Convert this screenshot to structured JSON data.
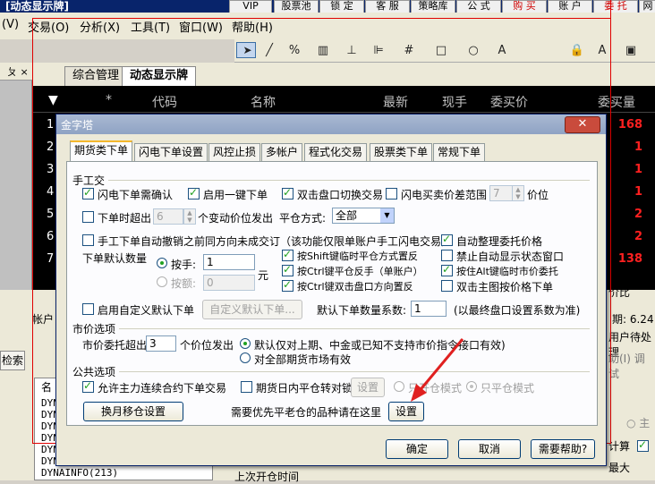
{
  "app": {
    "title": "[动态显示牌]",
    "top_buttons": [
      "VIP",
      "股票池",
      "锁 定",
      "客 服",
      "策略库",
      "公 式",
      "购 买",
      "账 户",
      "委 托",
      "网"
    ],
    "menu": [
      "(V)",
      "交易(O)",
      "分析(X)",
      "工具(T)",
      "窗口(W)",
      "帮助(H)"
    ],
    "toolbar_icons": [
      "pointer-icon",
      "line-icon",
      "percent-icon",
      "bar-icon",
      "ruler-icon",
      "channel-icon",
      "grid-icon",
      "rect-icon",
      "circle-icon",
      "text-icon",
      "lock-icon",
      "color-icon",
      "save-icon"
    ],
    "left_head": "ㄆ ×",
    "tabs": [
      "综合管理",
      "动态显示牌"
    ],
    "grid_headers": [
      "*",
      "代码",
      "名称",
      "最新",
      "现手",
      "委买价",
      "委买量"
    ],
    "rows": [
      {
        "num": "1",
        "val": "168"
      },
      {
        "num": "2",
        "val": "1"
      },
      {
        "num": "3",
        "val": "1"
      },
      {
        "num": "4",
        "val": "1"
      },
      {
        "num": "5",
        "val": "2"
      },
      {
        "num": "6",
        "val": "2"
      },
      {
        "num": "7",
        "val": "138"
      }
    ],
    "bottom": {
      "account_label": "帐户",
      "search_button": "检索",
      "col_a": "名",
      "dyn_rows": [
        "DYN",
        "DYN",
        "DYN",
        "DYN",
        "DYN",
        "DYN",
        "DYNAINFO(213)"
      ],
      "last_time_label": "上次开仓时间",
      "right_price": "价比",
      "right_amount": "期: 6.24",
      "user_wait": "用户待处理",
      "help_hint": "助(I) 调试",
      "zhu": "○ 主",
      "calc": "计算",
      "max": "最大",
      "calc_val": "1"
    }
  },
  "dialog": {
    "title": "金字塔",
    "close": "✕",
    "tabs": [
      "期货类下单",
      "闪电下单设置",
      "风控止损",
      "多帐户",
      "程式化交易",
      "股票类下单",
      "常规下单"
    ],
    "sec_manual": "手工交",
    "chk_flash_confirm": "闪电下单需确认",
    "chk_one_click": "启用一键下单",
    "chk_dblclick_switch": "双击盘口切换交易",
    "chk_flash_spread": "闪电买卖价差范围",
    "spread_value": "7",
    "spread_unit": "价位",
    "chk_timeout": "下单时超出",
    "timeout_value": "6",
    "timeout_suffix": "个变动价位发出",
    "close_mode_label": "平仓方式:",
    "close_mode_value": "全部",
    "chk_auto_cancel": "手工下单自动撤销之前同方向未成交订（该功能仅限单账户手工闪电交易）",
    "chk_auto_arrange": "自动整理委托价格",
    "default_qty_label": "下单默认数量",
    "radio_by_lot": "按手:",
    "lot_value": "1",
    "radio_by_amount": "按额:",
    "amount_value": "0",
    "amount_unit": "元",
    "chk_shift": "按Shift键临时平仓方式置反",
    "chk_no_status": "禁止自动显示状态窗口",
    "chk_ctrl_reverse": "按Ctrl键平仓反手（单账户）",
    "chk_alt_market": "按住Alt键临时市价委托",
    "chk_ctrl_dbl": "按Ctrl键双击盘口方向置反",
    "chk_dbl_chart": "双击主图按价格下单",
    "chk_custom_default": "启用自定义默认下单",
    "btn_custom_default": "自定义默认下单...",
    "coef_label": "默认下单数量系数:",
    "coef_value": "1",
    "coef_note": "(以最终盘口设置系数为准)",
    "sec_market": "市价选项",
    "market_over_label": "市价委托超出",
    "market_over_value": "3",
    "market_over_suffix": "个价位发出",
    "radio_default_only": "默认仅对上期、中金或已知不支持市价指令接口有效)",
    "radio_all_valid": "对全部期货市场有效",
    "sec_public": "公共选项",
    "chk_allow_main": "允许主力连续合约下单交易",
    "chk_intraday_close": "期货日内平仓转对锁",
    "btn_setup1": "设置",
    "radio_close_only": "只开仓模式",
    "radio_open_only": "只平仓模式",
    "btn_month_move": "换月移仓设置",
    "priority_label": "需要优先平老仓的品种请在这里",
    "btn_setup2": "设置",
    "btn_ok": "确定",
    "btn_cancel": "取消",
    "btn_help": "需要帮助?"
  }
}
